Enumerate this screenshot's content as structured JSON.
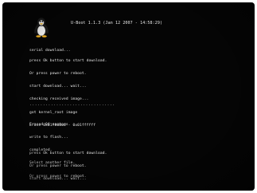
{
  "header": {
    "title": "U-Boot 1.1.3 (Jan 12 2007 - 14:58:29)"
  },
  "block1": {
    "lines": [
      "serial download..."
    ]
  },
  "block2": {
    "lines": [
      "press Ok button to start download.",
      "Or press power to reboot.",
      "start download... wait...",
      "checking received image...",
      "got kernel_root image",
      "Erase 0x01f80000 - 0x01ffffff"
    ]
  },
  "separator": {
    "text": "................................"
  },
  "block3": {
    "lines": [
      "Erased 04 sectors",
      "write to flash...",
      "completed.",
      "Select another file.",
      "Or press power to reboot."
    ]
  },
  "block4": {
    "lines": [
      "press Ok button to start download.",
      "Or press power to reboot.",
      "start download... wait..."
    ]
  },
  "colors": {
    "screen_bg": "#050505",
    "text": "#e8e8e8"
  },
  "icons": {
    "logo": "tux-penguin-icon"
  }
}
